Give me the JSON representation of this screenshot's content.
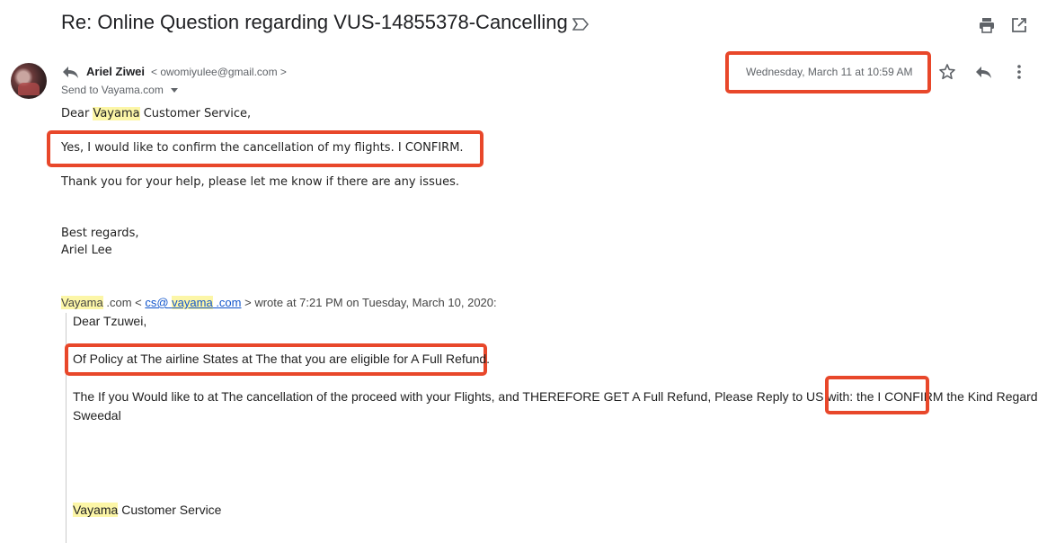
{
  "subject": "Re: Online Question regarding VUS-14855378-Cancelling",
  "sender": {
    "name": "Ariel Ziwei",
    "email": "< owomiyulee@gmail.com >",
    "send_to": "Send to Vayama.com",
    "date": "Wednesday, March 11 at 10:59 AM"
  },
  "body": {
    "greeting_pre": "Dear ",
    "greeting_hl": "Vayama",
    "greeting_post": " Customer Service,",
    "confirm_line": "Yes, I would like to confirm the cancellation of my flights. I CONFIRM.",
    "thanks_line": "Thank you for your help, please let me know if there are any issues.",
    "signoff": "Best regards,",
    "signature": "Ariel Lee"
  },
  "quote": {
    "head_vayama": "Vayama",
    "head_com": " .com < ",
    "link_cs": "cs@",
    "link_vayama": "vayama",
    "link_com": " .com",
    "head_tail": " > wrote at 7:21 PM on Tuesday, March 10, 2020:",
    "greeting": "Dear Tzuwei,",
    "policy_line": "Of Policy at The airline States at The that you are eligible for A Full Refund.",
    "paragraph_line1": "The If you Would like to at The cancellation of the proceed with your Flights, and THEREFORE GET A Full Refund, Please Reply to US with: the I CONFIRM the Kind Regards,",
    "paragraph_line2": "Sweedal",
    "footer_hl": "Vayama",
    "footer_tail": " Customer Service"
  },
  "icons": [
    "label-icon",
    "print-icon",
    "open-in-new-icon",
    "reply-arrow-icon",
    "star-icon",
    "reply-icon",
    "more-vert-icon",
    "caret-down-icon"
  ],
  "colors": {
    "highlight": "#fcf6a7",
    "annotation_red": "#e8472a",
    "link": "#1155cc"
  }
}
